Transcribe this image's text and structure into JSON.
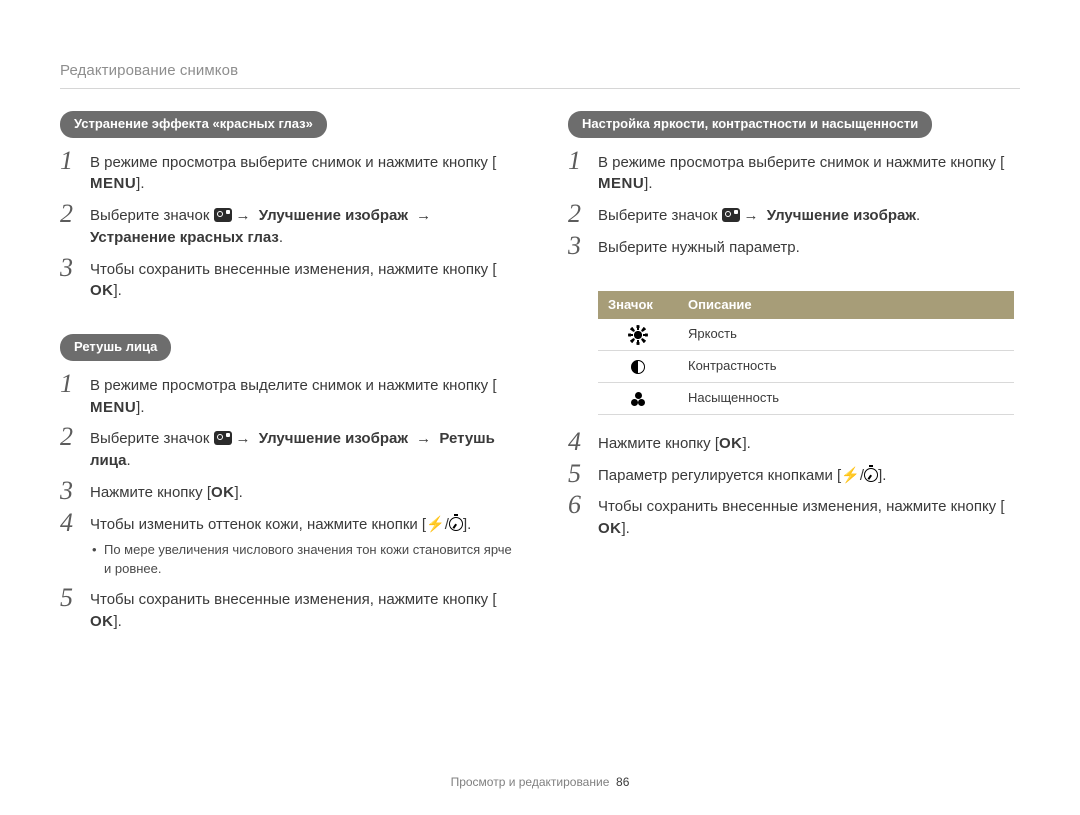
{
  "page_title": "Редактирование снимков",
  "footer": {
    "section": "Просмотр и редактирование",
    "page": "86"
  },
  "buttons": {
    "menu": "MENU",
    "ok": "OK"
  },
  "arrow": "→",
  "left": {
    "section_a": {
      "heading": "Устранение эффекта «красных глаз»",
      "step1_a": "В режиме просмотра выберите снимок и нажмите кнопку [",
      "step1_b": "].",
      "step2_a": "Выберите значок ",
      "step2_b": " Улучшение изображ ",
      "step2_c": " Устранение красных глаз",
      "step2_d": ".",
      "step3_a": "Чтобы сохранить внесенные изменения, нажмите кнопку [",
      "step3_b": "]."
    },
    "section_b": {
      "heading": "Ретушь лица",
      "step1_a": "В режиме просмотра выделите снимок и нажмите кнопку [",
      "step1_b": "].",
      "step2_a": "Выберите значок ",
      "step2_b": " Улучшение изображ ",
      "step2_c": " Ретушь лица",
      "step2_d": ".",
      "step3_a": "Нажмите кнопку [",
      "step3_b": "].",
      "step4_a": "Чтобы изменить оттенок кожи, нажмите кнопки [",
      "step4_b": "/",
      "step4_c": "].",
      "step4_note": "По мере увеличения числового значения тон кожи становится ярче и ровнее.",
      "step5_a": "Чтобы сохранить внесенные изменения, нажмите кнопку [",
      "step5_b": "]."
    }
  },
  "right": {
    "section_c": {
      "heading": "Настройка яркости, контрастности и насыщенности",
      "step1_a": "В режиме просмотра выберите снимок и нажмите кнопку [",
      "step1_b": "].",
      "step2_a": "Выберите значок ",
      "step2_b": " Улучшение изображ",
      "step2_c": ".",
      "step3": "Выберите нужный параметр.",
      "table": {
        "h1": "Значок",
        "h2": "Описание",
        "r1": "Яркость",
        "r2": "Контрастность",
        "r3": "Насыщенность"
      },
      "step4_a": "Нажмите кнопку [",
      "step4_b": "].",
      "step5_a": "Параметр регулируется кнопками [",
      "step5_b": "/",
      "step5_c": "].",
      "step6_a": "Чтобы сохранить внесенные изменения, нажмите кнопку [",
      "step6_b": "]."
    }
  }
}
